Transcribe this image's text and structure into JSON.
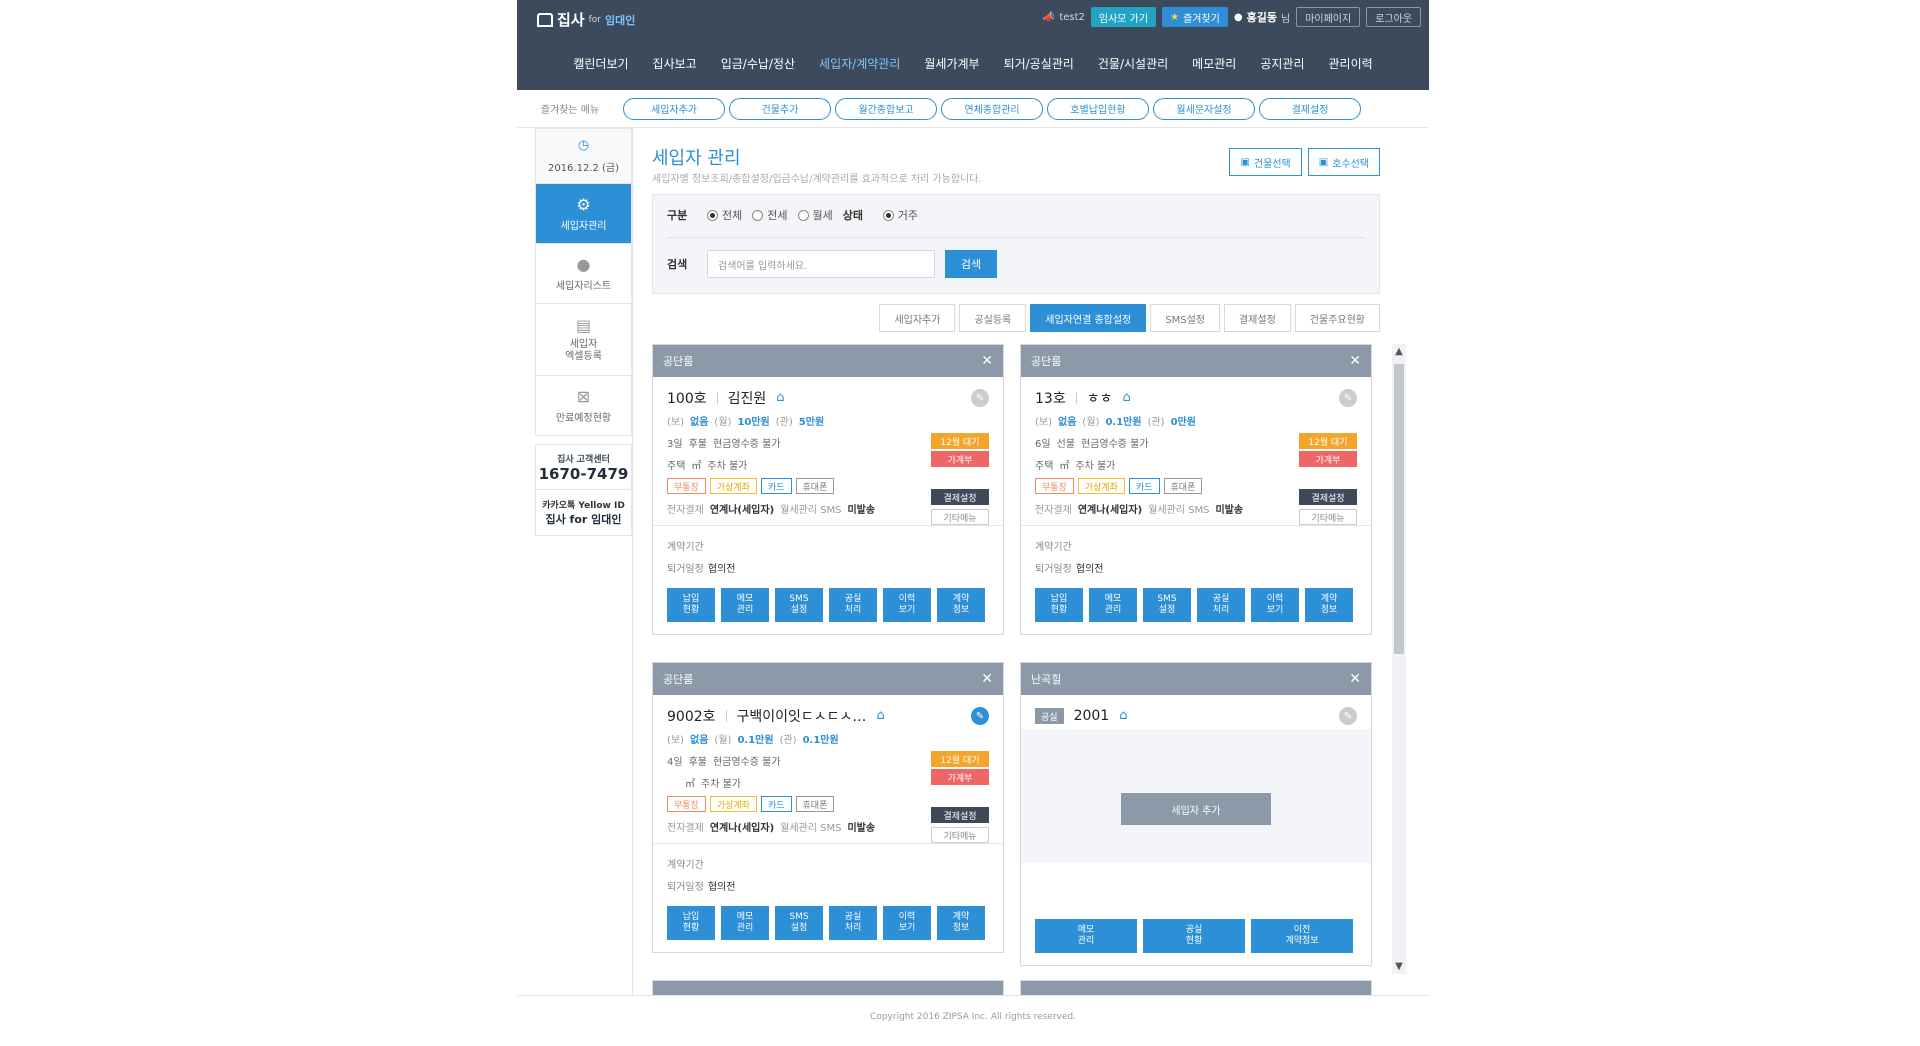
{
  "header": {
    "logo_main": "집사",
    "logo_for": "for",
    "logo_sub": "임대인",
    "user_id": "test2",
    "btn_goto": "임사모 가기",
    "btn_favorite": "즐겨찾기",
    "user_name": "홍길동",
    "user_suffix": "님",
    "btn_mypage": "마이페이지",
    "btn_logout": "로그아웃"
  },
  "nav": [
    "캘린더보기",
    "집사보고",
    "입금/수납/정산",
    "세입자/계약관리",
    "월세가계부",
    "퇴거/공실관리",
    "건물/시설관리",
    "메모관리",
    "공지관리",
    "관리이력"
  ],
  "nav_active": "세입자/계약관리",
  "favorites": {
    "label": "즐겨찾는 메뉴",
    "items": [
      "세입자추가",
      "건물추가",
      "월간종합보고",
      "연체종합관리",
      "호별납입현황",
      "월세문자설정",
      "결제설정"
    ]
  },
  "sidebar": {
    "date": "2016.12.2 (금)",
    "items": [
      {
        "label": "세입자관리",
        "icon": "gear-icon"
      },
      {
        "label": "세입자리스트",
        "icon": "person-icon"
      },
      {
        "label": "세입자\n엑셀등록",
        "icon": "excel-icon"
      },
      {
        "label": "만료예정현황",
        "icon": "calendar-x-icon"
      }
    ],
    "cc_title": "집사 고객센터",
    "cc_number": "1670-7479",
    "kakao_title": "카카오톡 Yellow ID",
    "kakao_name": "집사 for 임대인"
  },
  "page": {
    "title": "세입자 관리",
    "desc": "세입자별 정보조회/종합설정/입금수납/계약관리를 효과적으로 처리 가능합니다.",
    "btn_building": "건물선택",
    "btn_unit": "호수선택"
  },
  "filter": {
    "type_label": "구분",
    "type_options": [
      "전체",
      "전세",
      "월세"
    ],
    "type_selected": "전체",
    "status_label": "상태",
    "status_option": "거주",
    "search_label": "검색",
    "search_placeholder": "검색어를 입력하세요.",
    "search_btn": "검색"
  },
  "tabs": [
    "세입자추가",
    "공실등록",
    "세입자연결 종합설정",
    "SMS설정",
    "결제설정",
    "건물주요현황"
  ],
  "tab_active": "세입자연결 종합설정",
  "cards": [
    {
      "building": "공단룸",
      "unit": "100호",
      "tenant": "김진원",
      "deposit_k": "(보)",
      "deposit": "없음",
      "rent_k": "(월)",
      "rent": "10만원",
      "mgmt_k": "(관)",
      "mgmt": "5만원",
      "badge1": "12월 대기",
      "badge2": "가계부",
      "day": "3일",
      "pay": "후불",
      "receipt": "현금영수증 불가",
      "house": "주택",
      "area": "㎡",
      "parking": "주차 불가",
      "chips": [
        "무통장",
        "가상계좌",
        "카드",
        "휴대폰"
      ],
      "pay_setting": "결제설정",
      "etc_menu": "기타메뉴",
      "esign_k": "전자결제",
      "esign": "연계나(세입자)",
      "sms_k": "월세관리 SMS",
      "sms": "미발송",
      "contract_k": "계약기간",
      "moveout_k": "퇴거일정",
      "moveout": "협의전"
    },
    {
      "building": "공단룸",
      "unit": "13호",
      "tenant": "ㅎㅎ",
      "deposit_k": "(보)",
      "deposit": "없음",
      "rent_k": "(월)",
      "rent": "0.1만원",
      "mgmt_k": "(관)",
      "mgmt": "0만원",
      "badge1": "12월 대기",
      "badge2": "가계부",
      "day": "6일",
      "pay": "선불",
      "receipt": "현금영수증 불가",
      "house": "주택",
      "area": "㎡",
      "parking": "주차 불가",
      "chips": [
        "무통장",
        "가상계좌",
        "카드",
        "휴대폰"
      ],
      "pay_setting": "결제설정",
      "etc_menu": "기타메뉴",
      "esign_k": "전자결제",
      "esign": "연계나(세입자)",
      "sms_k": "월세관리 SMS",
      "sms": "미발송",
      "contract_k": "계약기간",
      "moveout_k": "퇴거일정",
      "moveout": "협의전"
    },
    {
      "building": "공단룸",
      "unit": "9002호",
      "tenant": "구백이이잇ㄷㅅㄷㅅ…",
      "deposit_k": "(보)",
      "deposit": "없음",
      "rent_k": "(월)",
      "rent": "0.1만원",
      "mgmt_k": "(관)",
      "mgmt": "0.1만원",
      "badge1": "12월 대기",
      "badge2": "가계부",
      "day": "4일",
      "pay": "후불",
      "receipt": "현금영수증 불가",
      "house": "",
      "area": "㎡",
      "parking": "주차 불가",
      "chips": [
        "무통장",
        "가상계좌",
        "카드",
        "휴대폰"
      ],
      "pay_setting": "결제설정",
      "etc_menu": "기타메뉴",
      "esign_k": "전자결제",
      "esign": "연계나(세입자)",
      "sms_k": "월세관리 SMS",
      "sms": "미발송",
      "contract_k": "계약기간",
      "moveout_k": "퇴거일정",
      "moveout": "협의전"
    }
  ],
  "card_actions": [
    "납입\n현황",
    "메모\n관리",
    "SMS\n설정",
    "공실\n처리",
    "이력\n보기",
    "계약\n정보"
  ],
  "vacant_card": {
    "building": "난곡힐",
    "status": "공실",
    "unit": "2001",
    "add_btn": "세입자 추가",
    "actions": [
      "메모\n관리",
      "공실\n현황",
      "이전\n계약정보"
    ]
  },
  "footer": {
    "copyright": "Copyright 2016 ZIPSA Inc. All rights reserved."
  }
}
